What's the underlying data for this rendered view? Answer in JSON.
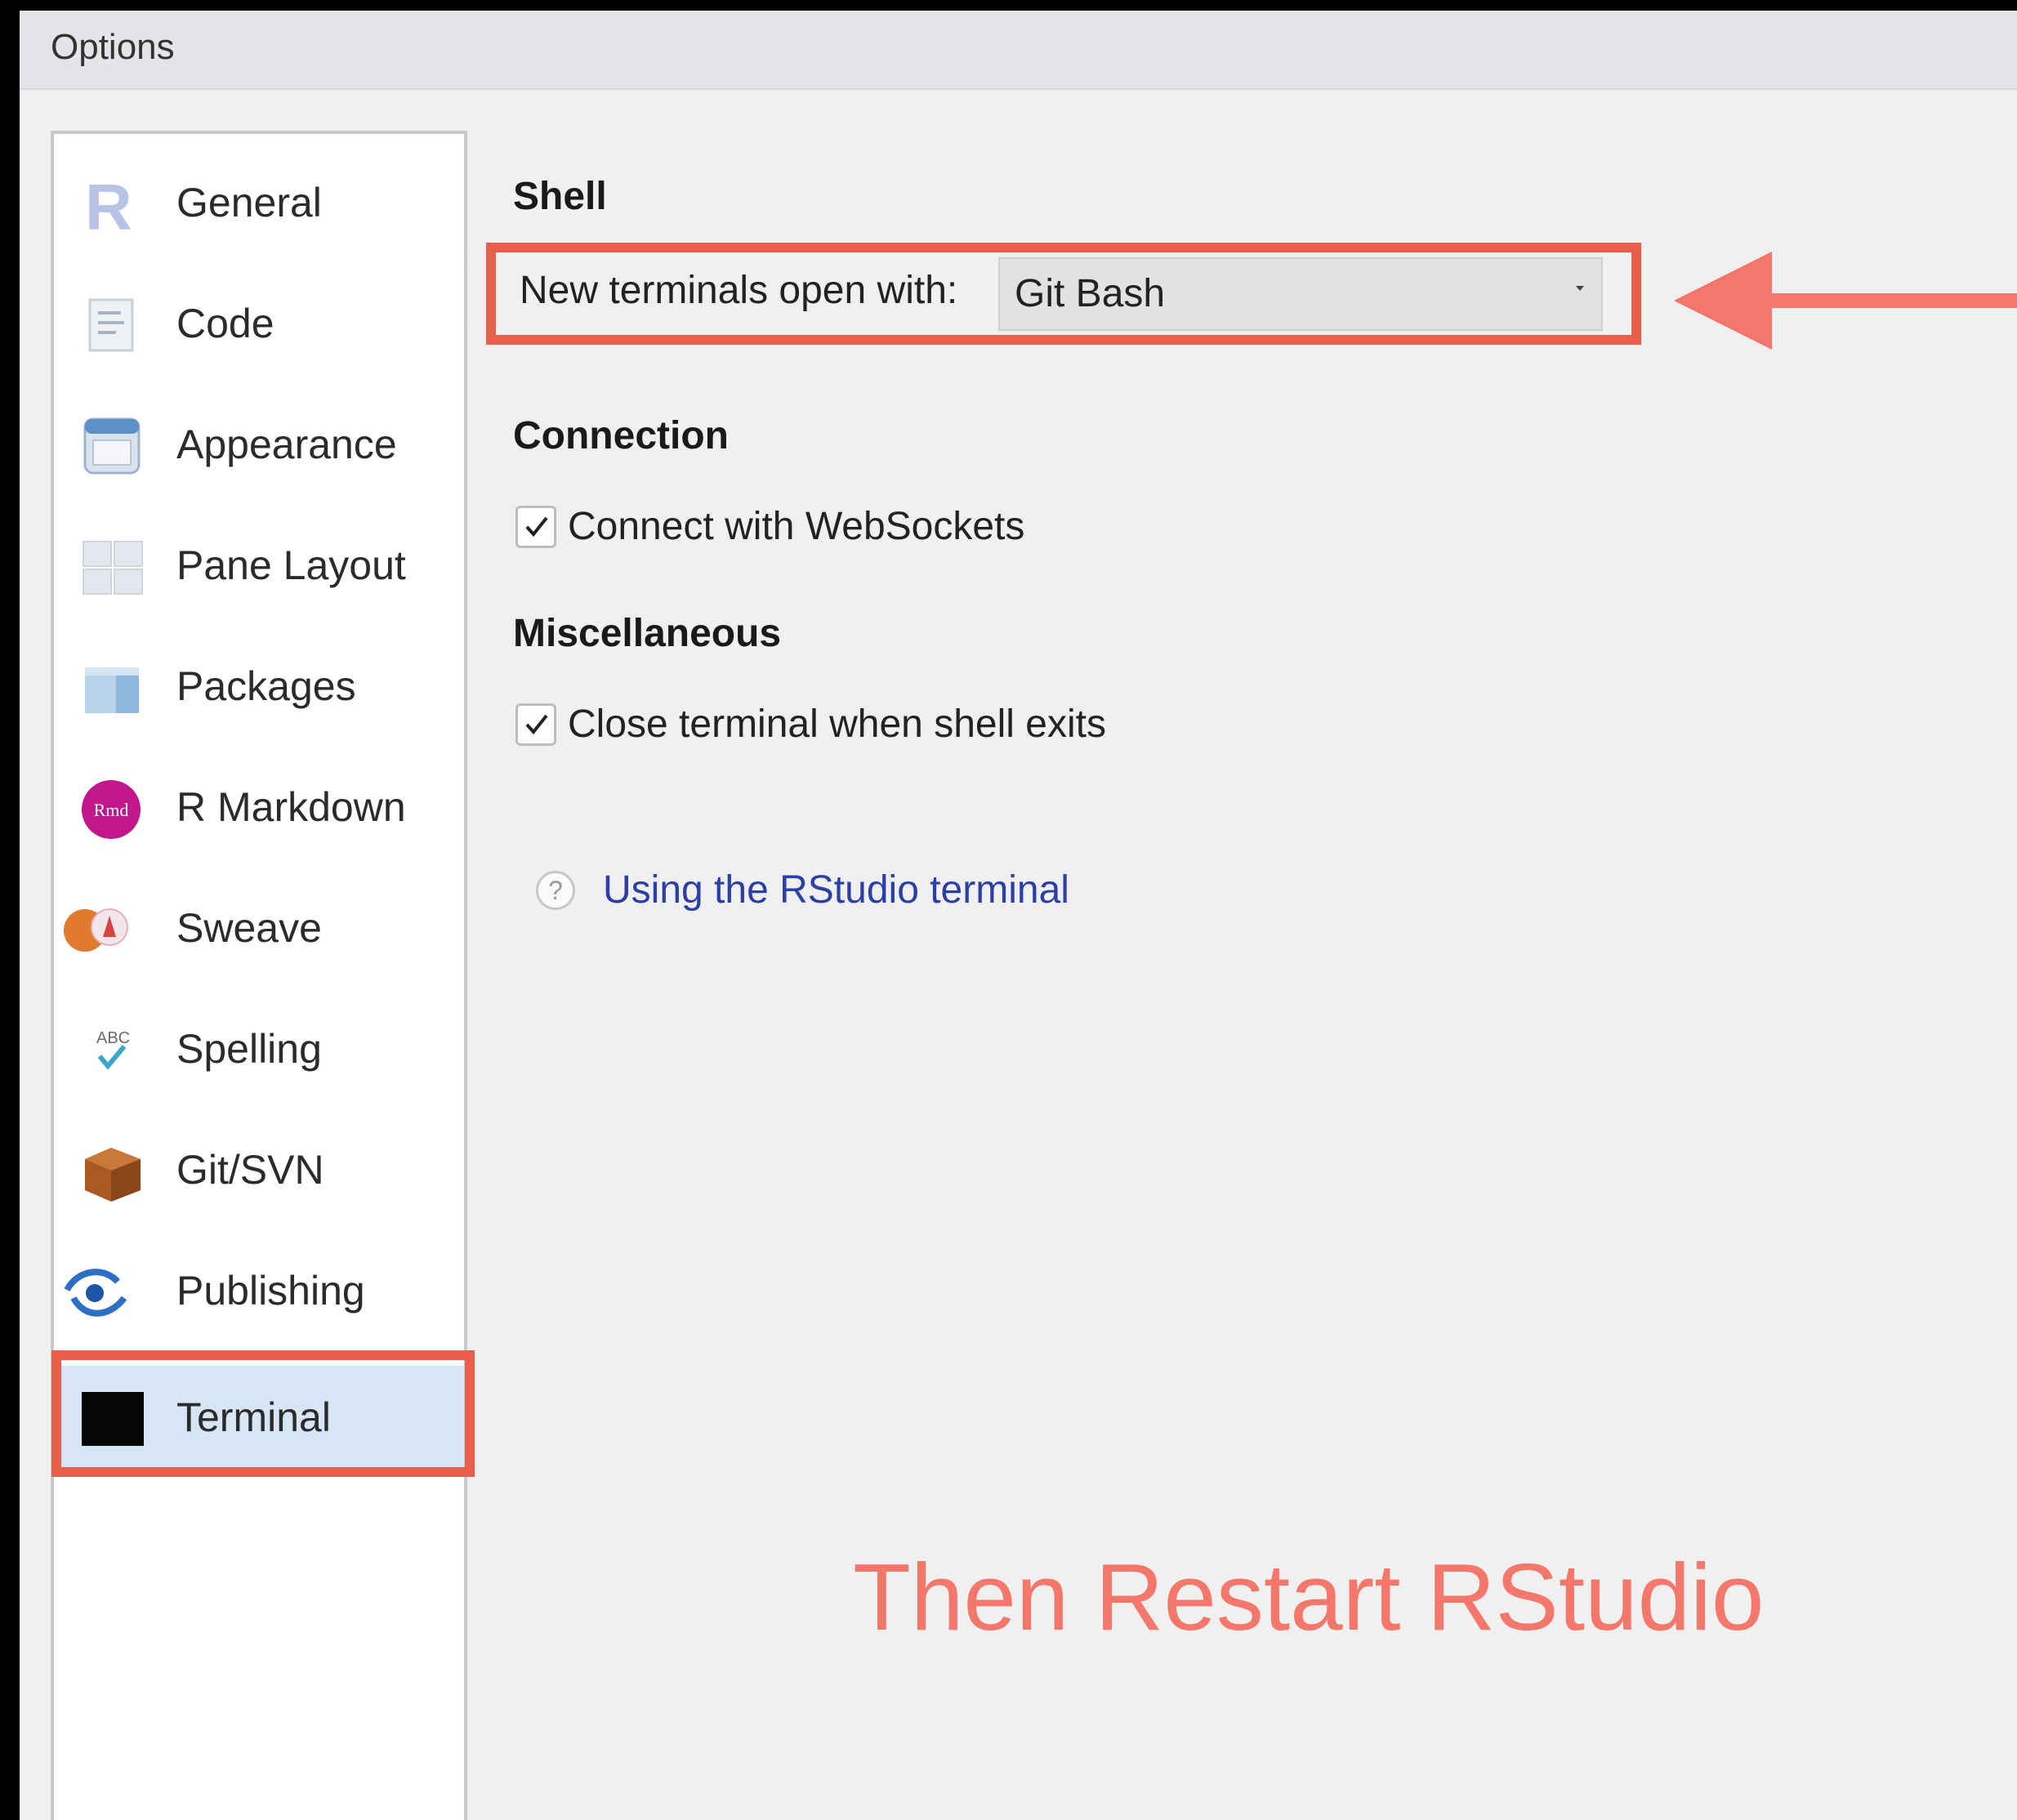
{
  "window": {
    "title": "Options"
  },
  "sidebar": {
    "items": [
      {
        "label": "General",
        "icon": "r-logo-icon",
        "selected": false
      },
      {
        "label": "Code",
        "icon": "code-icon",
        "selected": false
      },
      {
        "label": "Appearance",
        "icon": "appearance-icon",
        "selected": false
      },
      {
        "label": "Pane Layout",
        "icon": "pane-layout-icon",
        "selected": false
      },
      {
        "label": "Packages",
        "icon": "packages-icon",
        "selected": false
      },
      {
        "label": "R Markdown",
        "icon": "rmarkdown-icon",
        "selected": false
      },
      {
        "label": "Sweave",
        "icon": "sweave-icon",
        "selected": false
      },
      {
        "label": "Spelling",
        "icon": "spelling-icon",
        "selected": false
      },
      {
        "label": "Git/SVN",
        "icon": "git-svn-icon",
        "selected": false
      },
      {
        "label": "Publishing",
        "icon": "publishing-icon",
        "selected": false
      },
      {
        "label": "Terminal",
        "icon": "terminal-icon",
        "selected": true
      }
    ]
  },
  "shell": {
    "title": "Shell",
    "new_terminals_label": "New terminals open with:",
    "new_terminals_value": "Git Bash"
  },
  "connection": {
    "title": "Connection",
    "websockets_label": "Connect with WebSockets",
    "websockets_checked": true
  },
  "misc": {
    "title": "Miscellaneous",
    "close_terminal_label": "Close terminal when shell exits",
    "close_terminal_checked": true
  },
  "help": {
    "link_text": "Using the RStudio terminal",
    "icon_glyph": "?"
  },
  "annotation": {
    "note": "Then Restart RStudio",
    "color": "#f4776c",
    "highlight_color": "#e8604c"
  },
  "colors": {
    "link": "#2b3fa6",
    "selected_bg": "#d6e6f7"
  }
}
